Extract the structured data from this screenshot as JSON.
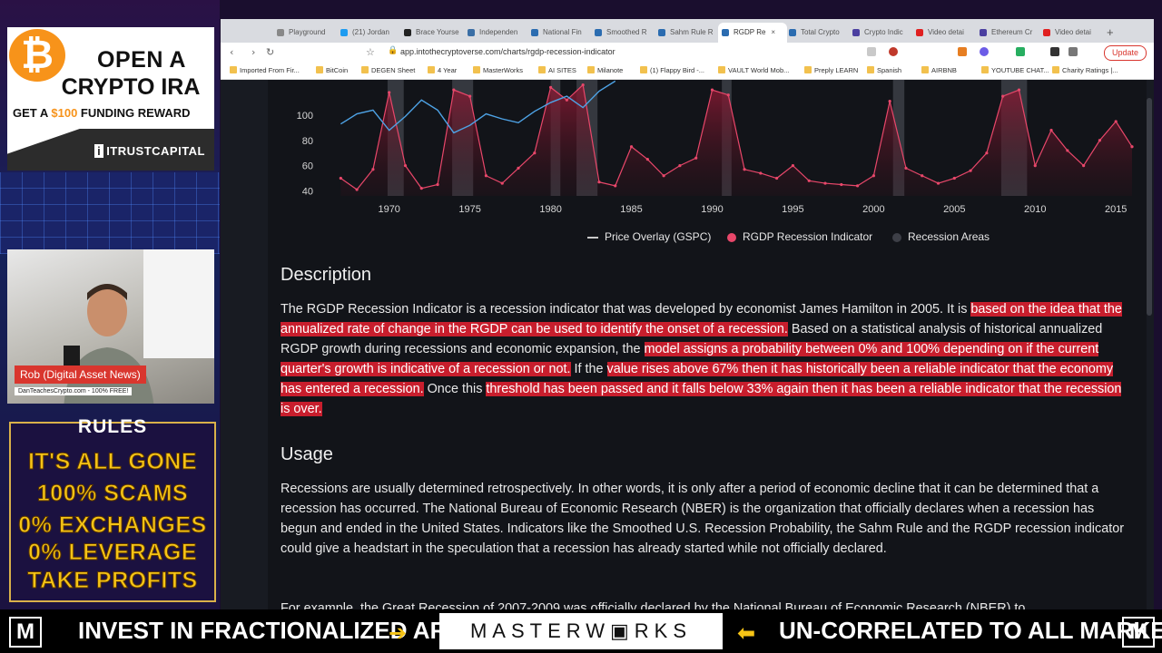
{
  "overlay": {
    "ad": {
      "coin": "₿",
      "line1": "OPEN A",
      "line2": "CRYPTO IRA",
      "line3_prefix": "GET A ",
      "line3_amount": "$100",
      "line3_suffix": " FUNDING REWARD",
      "brand": "ITRUSTCAPITAL",
      "brand_mark": "i"
    },
    "webcam": {
      "name": "Rob (Digital Asset News)",
      "site": "DanTeachesCrypto.com - 100% FREE!"
    },
    "rules": {
      "heading": "RULES",
      "lines": [
        "IT'S ALL GONE",
        "100% SCAMS",
        "0% EXCHANGES",
        "0% LEVERAGE",
        "TAKE PROFITS"
      ]
    },
    "ticker": {
      "left_text": "INVEST IN FRACTIONALIZED ART",
      "logo": "MASTERW▣RKS",
      "right_text": "UN-CORRELATED TO ALL MARKETS!",
      "m_icon": "M",
      "arrow_right": "➔",
      "arrow_left": "⬅"
    }
  },
  "browser": {
    "tabs": [
      {
        "label": "Playground",
        "color": "#888888"
      },
      {
        "label": "(21) Jordan",
        "color": "#1d9bf0"
      },
      {
        "label": "Brace Yourse",
        "color": "#222222"
      },
      {
        "label": "Independen",
        "color": "#3a6ea5"
      },
      {
        "label": "National Fin",
        "color": "#2b6cb0"
      },
      {
        "label": "Smoothed R",
        "color": "#2b6cb0"
      },
      {
        "label": "Sahm Rule R",
        "color": "#2b6cb0"
      },
      {
        "label": "RGDP Re",
        "color": "#2b6cb0",
        "active": true
      },
      {
        "label": "Total Crypto",
        "color": "#2b6cb0"
      },
      {
        "label": "Crypto Indic",
        "color": "#4b3fa0"
      },
      {
        "label": "Video detai",
        "color": "#e02020"
      },
      {
        "label": "Ethereum Cr",
        "color": "#4b3fa0"
      },
      {
        "label": "Video detai",
        "color": "#e02020"
      }
    ],
    "url": "app.intothecryptoverse.com/charts/rgdp-recession-indicator",
    "update_label": "Update",
    "bookmarks": [
      "Imported From Fir...",
      "BitCoin",
      "DEGEN Sheet",
      "4 Year",
      "MasterWorks",
      "AI SITES",
      "Milanote",
      "(1) Flappy Bird -...",
      "VAULT World Mob...",
      "Preply LEARN",
      "Spanish",
      "AIRBNB",
      "YOUTUBE CHAT...",
      "Charity Ratings |..."
    ]
  },
  "chart_data": {
    "type": "line",
    "title": "",
    "xlabel": "",
    "ylabel": "",
    "x_ticks": [
      "1970",
      "1975",
      "1980",
      "1985",
      "1990",
      "1995",
      "2000",
      "2005",
      "2010",
      "2015"
    ],
    "y_ticks": [
      "100",
      "80",
      "60",
      "40"
    ],
    "series": [
      {
        "name": "Price Overlay (GSPC)",
        "color": "#4ea3e6",
        "x": [
          1967,
          1968,
          1969,
          1970,
          1971,
          1972,
          1973,
          1974,
          1975,
          1976,
          1977,
          1978,
          1979,
          1980,
          1981,
          1982,
          1983,
          1984
        ],
        "y": [
          93,
          101,
          104,
          88,
          99,
          112,
          104,
          86,
          92,
          101,
          97,
          94,
          103,
          110,
          115,
          106,
          119,
          127
        ]
      },
      {
        "name": "RGDP Recession Indicator",
        "color": "#e8476a",
        "x": [
          1967,
          1968,
          1969,
          1970,
          1971,
          1972,
          1973,
          1974,
          1975,
          1976,
          1977,
          1978,
          1979,
          1980,
          1981,
          1982,
          1983,
          1984,
          1985,
          1986,
          1987,
          1988,
          1989,
          1990,
          1991,
          1992,
          1993,
          1994,
          1995,
          1996,
          1997,
          1998,
          1999,
          2000,
          2001,
          2002,
          2003,
          2004,
          2005,
          2006,
          2007,
          2008,
          2009,
          2010,
          2011,
          2012,
          2013,
          2014,
          2015,
          2016
        ],
        "y": [
          50,
          41,
          57,
          118,
          60,
          42,
          45,
          120,
          115,
          52,
          46,
          58,
          70,
          122,
          112,
          124,
          47,
          44,
          75,
          65,
          52,
          60,
          66,
          120,
          116,
          57,
          54,
          50,
          60,
          48,
          46,
          45,
          44,
          52,
          111,
          58,
          52,
          46,
          50,
          56,
          70,
          115,
          120,
          60,
          88,
          72,
          60,
          80,
          95,
          75
        ]
      }
    ],
    "legend": [
      "Price Overlay (GSPC)",
      "RGDP Recession Indicator",
      "Recession Areas"
    ],
    "recession_areas": [
      [
        1969.9,
        1970.9
      ],
      [
        1973.9,
        1975.2
      ],
      [
        1980.0,
        1980.6
      ],
      [
        1981.6,
        1982.9
      ],
      [
        1990.6,
        1991.2
      ],
      [
        2001.2,
        2001.9
      ],
      [
        2007.9,
        2009.5
      ]
    ],
    "xlim": [
      1966.7,
      2016.9
    ],
    "ylim_visible": [
      36,
      128
    ],
    "grid": false,
    "legend_position": "bottom"
  },
  "description": {
    "heading": "Description",
    "segments": [
      {
        "t": "The RGDP Recession Indicator is a recession indicator that was developed by economist James Hamilton in 2005. It is ",
        "h": false
      },
      {
        "t": "based on the idea that the annualized rate of change in the RGDP can be used to identify the onset of a recession.",
        "h": true
      },
      {
        "t": " Based on a statistical analysis of historical annualized RGDP growth during recessions and economic expansion, the ",
        "h": false
      },
      {
        "t": "model assigns a probability between 0% and 100% depending on if the current quarter's growth is indicative of a recession or not.",
        "h": true
      },
      {
        "t": " If the ",
        "h": false
      },
      {
        "t": "value rises above 67% then it has historically been a reliable indicator that the economy has entered a recession.",
        "h": true
      },
      {
        "t": " Once this ",
        "h": false
      },
      {
        "t": "threshold has been passed and it falls below 33% again then it has been a reliable indicator that the recession is over.",
        "h": true
      }
    ]
  },
  "usage": {
    "heading": "Usage",
    "paragraph": "Recessions are usually determined retrospectively. In other words, it is only after a period of economic decline that it can be determined that a recession has occurred. The National Bureau of Economic Research (NBER) is the organization that officially declares when a recession has begun and ended in the United States. Indicators like the Smoothed U.S. Recession Probability, the Sahm Rule and the RGDP recession indicator could give a headstart in the speculation that a recession has already started while not officially declared.",
    "next_paragraph": "For example, the Great Recession of 2007-2009 was officially declared by the National Bureau of Economic Research (NBER) to"
  }
}
